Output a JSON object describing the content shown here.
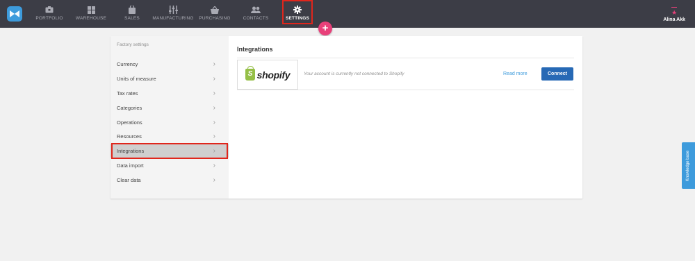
{
  "nav": {
    "items": [
      {
        "label": "PORTFOLIO",
        "icon": "portfolio-icon"
      },
      {
        "label": "WAREHOUSE",
        "icon": "warehouse-icon"
      },
      {
        "label": "SALES",
        "icon": "sales-icon"
      },
      {
        "label": "MANUFACTURING",
        "icon": "manufacturing-icon"
      },
      {
        "label": "PURCHASING",
        "icon": "purchasing-icon"
      },
      {
        "label": "CONTACTS",
        "icon": "contacts-icon"
      },
      {
        "label": "SETTINGS",
        "icon": "gear-icon"
      }
    ],
    "active": "SETTINGS",
    "plus_label": "+",
    "user_name": "Alina Akk"
  },
  "sidebar": {
    "title": "Factory settings",
    "items": [
      {
        "label": "Currency"
      },
      {
        "label": "Units of measure"
      },
      {
        "label": "Tax rates"
      },
      {
        "label": "Categories"
      },
      {
        "label": "Operations"
      },
      {
        "label": "Resources"
      },
      {
        "label": "Integrations"
      },
      {
        "label": "Data import"
      },
      {
        "label": "Clear data"
      }
    ],
    "active": "Integrations"
  },
  "main": {
    "title": "Integrations",
    "integration": {
      "name": "shopify",
      "status_text": "Your account is currently not connected to Shopify",
      "read_more_label": "Read more",
      "connect_label": "Connect"
    }
  },
  "knowledge_base_label": "Knowledge base",
  "colors": {
    "topbar": "#3c3d46",
    "accent_blue": "#3d9bdc",
    "connect_blue": "#2769b5",
    "pink": "#e8407a",
    "highlight_red": "#e0261c",
    "shopify_green": "#95bf47"
  }
}
